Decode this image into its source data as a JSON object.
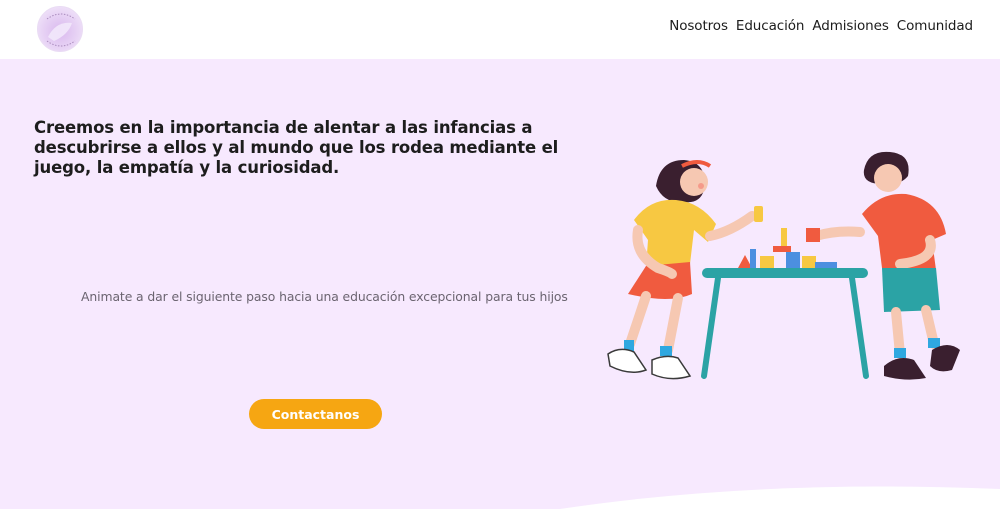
{
  "header": {
    "logo_icon": "school-logo-icon",
    "nav": [
      {
        "label": "Nosotros"
      },
      {
        "label": "Educación"
      },
      {
        "label": "Admisiones"
      },
      {
        "label": "Comunidad"
      }
    ]
  },
  "hero": {
    "headline": "Creemos en la importancia de alentar a las infancias a descubrirse a ellos y al mundo que los rodea mediante el juego, la empatía y la curiosidad.",
    "subtext": "Animate a dar el siguiente paso hacia una educación excepcional para tus hijos",
    "cta_label": "Contactanos",
    "illustration_icon": "children-playing-blocks-illustration"
  },
  "colors": {
    "hero_bg": "#f7e9fe",
    "cta": "#f6a612",
    "header_bg": "#ffffff"
  }
}
